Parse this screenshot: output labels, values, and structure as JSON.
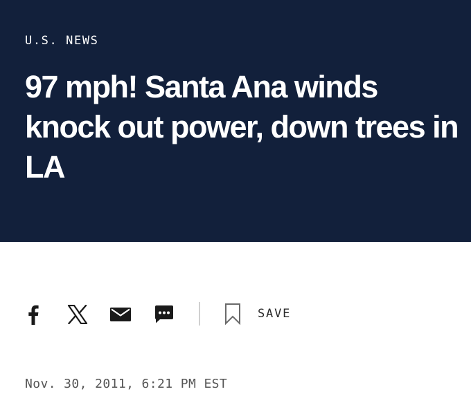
{
  "article": {
    "section": "U.S. NEWS",
    "headline": "97 mph! Santa Ana winds knock out power, down trees in LA",
    "dateline": "Nov. 30, 2011, 6:21 PM EST"
  },
  "share": {
    "icons": [
      "facebook-icon",
      "x-icon",
      "email-icon",
      "sms-icon",
      "bookmark-icon"
    ],
    "save_label": "SAVE"
  },
  "colors": {
    "hero_background": "#12203b",
    "hero_text": "#ffffff",
    "icon": "#1a1a1a",
    "dateline": "#555555"
  }
}
